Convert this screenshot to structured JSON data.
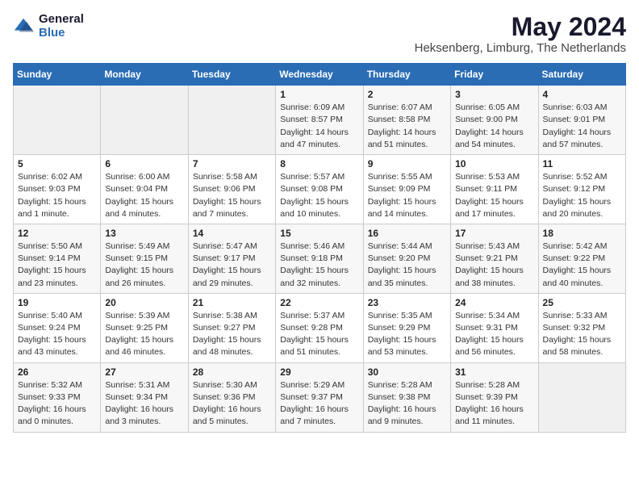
{
  "logo": {
    "general": "General",
    "blue": "Blue"
  },
  "header": {
    "title": "May 2024",
    "subtitle": "Heksenberg, Limburg, The Netherlands"
  },
  "weekdays": [
    "Sunday",
    "Monday",
    "Tuesday",
    "Wednesday",
    "Thursday",
    "Friday",
    "Saturday"
  ],
  "weeks": [
    [
      {
        "day": "",
        "info": ""
      },
      {
        "day": "",
        "info": ""
      },
      {
        "day": "",
        "info": ""
      },
      {
        "day": "1",
        "info": "Sunrise: 6:09 AM\nSunset: 8:57 PM\nDaylight: 14 hours\nand 47 minutes."
      },
      {
        "day": "2",
        "info": "Sunrise: 6:07 AM\nSunset: 8:58 PM\nDaylight: 14 hours\nand 51 minutes."
      },
      {
        "day": "3",
        "info": "Sunrise: 6:05 AM\nSunset: 9:00 PM\nDaylight: 14 hours\nand 54 minutes."
      },
      {
        "day": "4",
        "info": "Sunrise: 6:03 AM\nSunset: 9:01 PM\nDaylight: 14 hours\nand 57 minutes."
      }
    ],
    [
      {
        "day": "5",
        "info": "Sunrise: 6:02 AM\nSunset: 9:03 PM\nDaylight: 15 hours\nand 1 minute."
      },
      {
        "day": "6",
        "info": "Sunrise: 6:00 AM\nSunset: 9:04 PM\nDaylight: 15 hours\nand 4 minutes."
      },
      {
        "day": "7",
        "info": "Sunrise: 5:58 AM\nSunset: 9:06 PM\nDaylight: 15 hours\nand 7 minutes."
      },
      {
        "day": "8",
        "info": "Sunrise: 5:57 AM\nSunset: 9:08 PM\nDaylight: 15 hours\nand 10 minutes."
      },
      {
        "day": "9",
        "info": "Sunrise: 5:55 AM\nSunset: 9:09 PM\nDaylight: 15 hours\nand 14 minutes."
      },
      {
        "day": "10",
        "info": "Sunrise: 5:53 AM\nSunset: 9:11 PM\nDaylight: 15 hours\nand 17 minutes."
      },
      {
        "day": "11",
        "info": "Sunrise: 5:52 AM\nSunset: 9:12 PM\nDaylight: 15 hours\nand 20 minutes."
      }
    ],
    [
      {
        "day": "12",
        "info": "Sunrise: 5:50 AM\nSunset: 9:14 PM\nDaylight: 15 hours\nand 23 minutes."
      },
      {
        "day": "13",
        "info": "Sunrise: 5:49 AM\nSunset: 9:15 PM\nDaylight: 15 hours\nand 26 minutes."
      },
      {
        "day": "14",
        "info": "Sunrise: 5:47 AM\nSunset: 9:17 PM\nDaylight: 15 hours\nand 29 minutes."
      },
      {
        "day": "15",
        "info": "Sunrise: 5:46 AM\nSunset: 9:18 PM\nDaylight: 15 hours\nand 32 minutes."
      },
      {
        "day": "16",
        "info": "Sunrise: 5:44 AM\nSunset: 9:20 PM\nDaylight: 15 hours\nand 35 minutes."
      },
      {
        "day": "17",
        "info": "Sunrise: 5:43 AM\nSunset: 9:21 PM\nDaylight: 15 hours\nand 38 minutes."
      },
      {
        "day": "18",
        "info": "Sunrise: 5:42 AM\nSunset: 9:22 PM\nDaylight: 15 hours\nand 40 minutes."
      }
    ],
    [
      {
        "day": "19",
        "info": "Sunrise: 5:40 AM\nSunset: 9:24 PM\nDaylight: 15 hours\nand 43 minutes."
      },
      {
        "day": "20",
        "info": "Sunrise: 5:39 AM\nSunset: 9:25 PM\nDaylight: 15 hours\nand 46 minutes."
      },
      {
        "day": "21",
        "info": "Sunrise: 5:38 AM\nSunset: 9:27 PM\nDaylight: 15 hours\nand 48 minutes."
      },
      {
        "day": "22",
        "info": "Sunrise: 5:37 AM\nSunset: 9:28 PM\nDaylight: 15 hours\nand 51 minutes."
      },
      {
        "day": "23",
        "info": "Sunrise: 5:35 AM\nSunset: 9:29 PM\nDaylight: 15 hours\nand 53 minutes."
      },
      {
        "day": "24",
        "info": "Sunrise: 5:34 AM\nSunset: 9:31 PM\nDaylight: 15 hours\nand 56 minutes."
      },
      {
        "day": "25",
        "info": "Sunrise: 5:33 AM\nSunset: 9:32 PM\nDaylight: 15 hours\nand 58 minutes."
      }
    ],
    [
      {
        "day": "26",
        "info": "Sunrise: 5:32 AM\nSunset: 9:33 PM\nDaylight: 16 hours\nand 0 minutes."
      },
      {
        "day": "27",
        "info": "Sunrise: 5:31 AM\nSunset: 9:34 PM\nDaylight: 16 hours\nand 3 minutes."
      },
      {
        "day": "28",
        "info": "Sunrise: 5:30 AM\nSunset: 9:36 PM\nDaylight: 16 hours\nand 5 minutes."
      },
      {
        "day": "29",
        "info": "Sunrise: 5:29 AM\nSunset: 9:37 PM\nDaylight: 16 hours\nand 7 minutes."
      },
      {
        "day": "30",
        "info": "Sunrise: 5:28 AM\nSunset: 9:38 PM\nDaylight: 16 hours\nand 9 minutes."
      },
      {
        "day": "31",
        "info": "Sunrise: 5:28 AM\nSunset: 9:39 PM\nDaylight: 16 hours\nand 11 minutes."
      },
      {
        "day": "",
        "info": ""
      }
    ]
  ]
}
